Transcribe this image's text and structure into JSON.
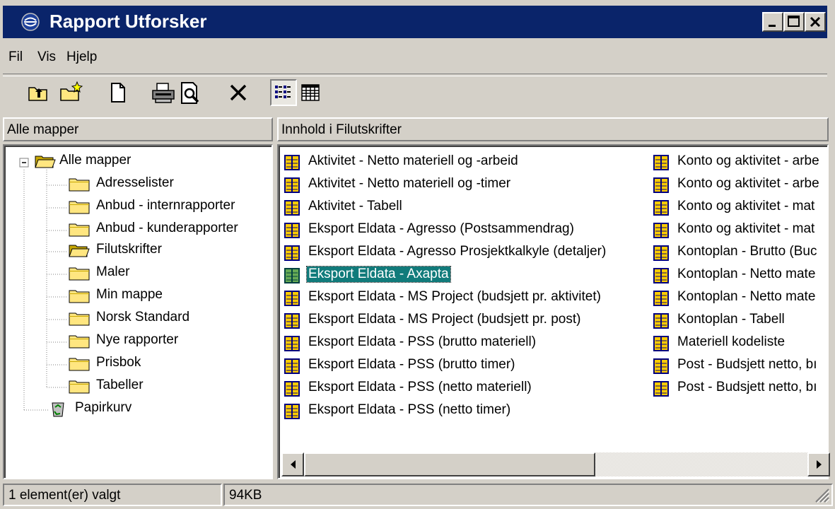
{
  "window": {
    "title": "Rapport Utforsker",
    "minimize_icon": "minimize-icon",
    "maximize_icon": "maximize-icon",
    "close_icon": "close-icon"
  },
  "menu": [
    "Fil",
    "Vis",
    "Hjelp"
  ],
  "toolbar": [
    {
      "name": "up-folder-icon"
    },
    {
      "name": "new-folder-icon"
    },
    {
      "name": "new-document-icon"
    },
    {
      "name": "print-icon"
    },
    {
      "name": "print-preview-icon"
    },
    {
      "name": "delete-icon"
    },
    {
      "name": "list-view-icon",
      "pressed": true
    },
    {
      "name": "details-view-icon"
    }
  ],
  "left_pane": {
    "header": "Alle mapper",
    "root": "Alle mapper",
    "folders": [
      "Adresselister",
      "Anbud - internrapporter",
      "Anbud - kunderapporter",
      "Filutskrifter",
      "Maler",
      "Min mappe",
      "Norsk Standard",
      "Nye rapporter",
      "Prisbok",
      "Tabeller"
    ],
    "open_folder": "Filutskrifter",
    "recycle": "Papirkurv"
  },
  "right_pane": {
    "header": "Innhold i Filutskrifter",
    "col1": [
      "Aktivitet - Netto materiell og -arbeid",
      "Aktivitet - Netto materiell og -timer",
      "Aktivitet - Tabell",
      "Eksport Eldata - Agresso (Postsammendrag)",
      "Eksport Eldata - Agresso Prosjektkalkyle (detaljer)",
      "Eksport Eldata - Axapta",
      "Eksport Eldata - MS Project (budsjett pr. aktivitet)",
      "Eksport Eldata - MS Project (budsjett pr. post)",
      "Eksport Eldata - PSS (brutto materiell)",
      "Eksport Eldata - PSS (brutto timer)",
      "Eksport Eldata - PSS (netto materiell)",
      "Eksport Eldata - PSS (netto timer)"
    ],
    "col2": [
      "Konto og aktivitet - arbe",
      "Konto og aktivitet - arbe",
      "Konto og aktivitet - mat",
      "Konto og aktivitet - mat",
      "Kontoplan - Brutto (Buc",
      "Kontoplan - Netto mate",
      "Kontoplan - Netto mate",
      "Kontoplan - Tabell",
      "Materiell kodeliste",
      "Post - Budsjett netto, bı",
      "Post - Budsjett netto, bı"
    ],
    "selected": "Eksport Eldata - Axapta"
  },
  "status": {
    "selection": "1 element(er) valgt",
    "size": "94KB"
  },
  "colors": {
    "titlebar": "#0a246a",
    "face": "#d4d0c8",
    "selection": "#117b7b"
  }
}
